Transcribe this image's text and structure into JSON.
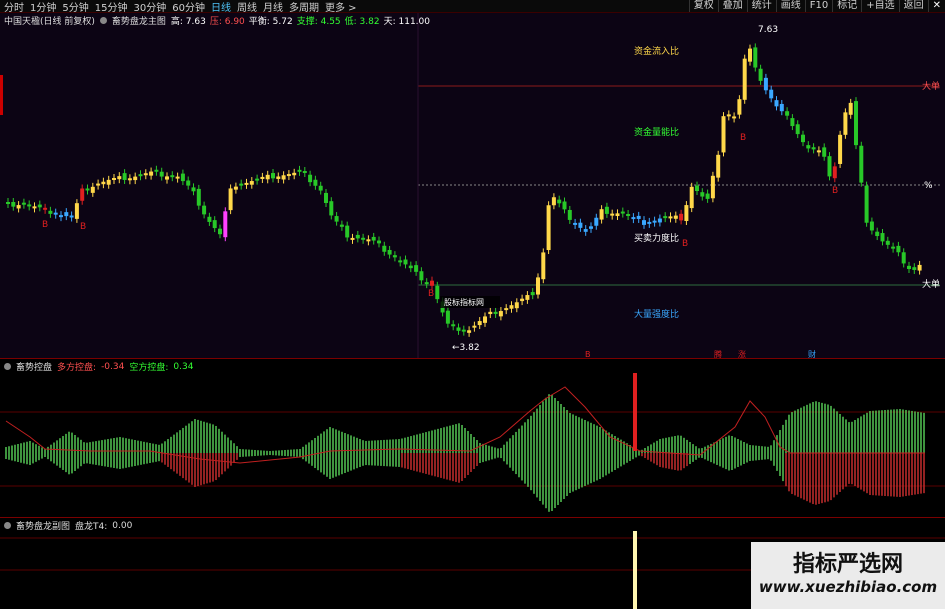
{
  "toolbar": {
    "periods": [
      "分时",
      "1分钟",
      "5分钟",
      "15分钟",
      "30分钟",
      "60分钟",
      "日线",
      "周线",
      "月线",
      "多周期",
      "更多 >"
    ],
    "active_period": "日线",
    "tools": [
      "复权",
      "叠加",
      "统计",
      "画线",
      "F10",
      "标记",
      "+自选",
      "返回"
    ],
    "close": "✕"
  },
  "main": {
    "stock": "中国天楹(日线 前复权)",
    "indicator": "畜势盘龙主图",
    "readout": [
      {
        "label": "高:",
        "value": "7.63",
        "color": "#ffffff"
      },
      {
        "label": "压:",
        "value": "6.90",
        "color": "#ff5050"
      },
      {
        "label": "平衡:",
        "value": "5.72",
        "color": "#ffffff"
      },
      {
        "label": "支撑:",
        "value": "4.55",
        "color": "#33ff33"
      },
      {
        "label": "低:",
        "value": "3.82",
        "color": "#33ff33"
      },
      {
        "label": "天:",
        "value": "111.00",
        "color": "#ffffff"
      }
    ],
    "labels": {
      "inflow": "资金流入比",
      "energy": "资金量能比",
      "buy": "买卖力度比",
      "volume": "大量强度比",
      "dadan_top": "大单",
      "dadan_bottom": "大单",
      "pct": "%",
      "high_note": "7.63",
      "low_note": "←3.82",
      "tooltip": "股标指标网"
    },
    "bottom_marks": [
      "B",
      "腾",
      "涨",
      "财"
    ]
  },
  "sub1": {
    "name": "畜势控盘",
    "bull_label": "多方控盘:",
    "bull_value": "-0.34",
    "bear_label": "空方控盘:",
    "bear_value": "0.34"
  },
  "sub2": {
    "name": "畜势盘龙副图",
    "t4_label": "盘龙T4:",
    "t4_value": "0.00"
  },
  "watermark": {
    "title": "指标严选网",
    "url": "www.xuezhibiao.com"
  },
  "colors": {
    "up": "#ffd84a",
    "down": "#28c828",
    "blue": "#3aa8ff",
    "magenta": "#ff40ff",
    "red": "#e02020",
    "bg": "#0c0414"
  }
}
